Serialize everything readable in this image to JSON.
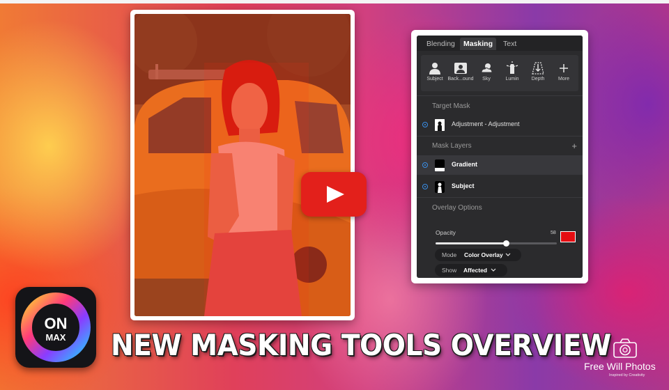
{
  "panel": {
    "tabs": [
      {
        "label": "Blending",
        "active": false
      },
      {
        "label": "Masking",
        "active": true
      },
      {
        "label": "Text",
        "active": false
      }
    ],
    "tools": [
      {
        "label": "Subject",
        "icon": "person-icon"
      },
      {
        "label": "Back...ound",
        "icon": "background-icon"
      },
      {
        "label": "Sky",
        "icon": "sky-icon"
      },
      {
        "label": "Lumin",
        "icon": "luminance-icon"
      },
      {
        "label": "Depth",
        "icon": "depth-icon"
      },
      {
        "label": "More",
        "icon": "plus-icon"
      }
    ],
    "target_mask": {
      "title": "Target Mask",
      "item": "Adjustment - Adjustment"
    },
    "mask_layers": {
      "title": "Mask Layers",
      "items": [
        {
          "label": "Gradient",
          "selected": true
        },
        {
          "label": "Subject",
          "selected": false
        }
      ]
    },
    "overlay": {
      "title": "Overlay Options",
      "opacity_label": "Opacity",
      "opacity_value": "58",
      "opacity_fraction": 0.58,
      "overlay_color": "#e50d12",
      "mode_label": "Mode",
      "mode_value": "Color Overlay",
      "show_label": "Show",
      "show_value": "Affected"
    }
  },
  "logo": {
    "line1": "ON",
    "line2": "MAX"
  },
  "headline": "NEW MASKING TOOLS OVERVIEW",
  "watermark": {
    "name": "Free Will Photos",
    "tagline": "Inspired by Creativity"
  },
  "colors": {
    "play_red": "#e3201b",
    "panel_bg": "#2b2b2d",
    "accent_blue": "#3a8ee6"
  }
}
